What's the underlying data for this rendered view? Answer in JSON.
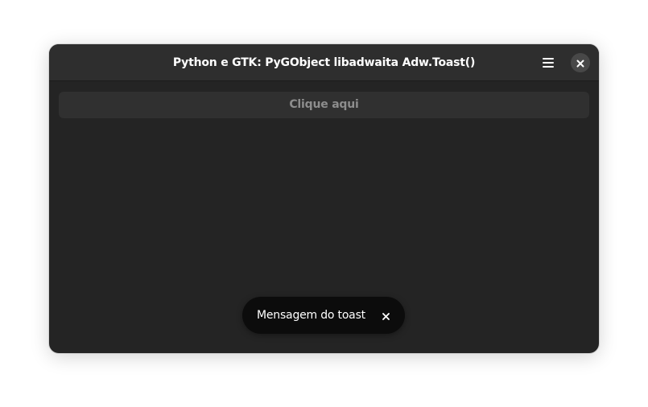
{
  "window": {
    "title": "Python e GTK: PyGObject libadwaita Adw.Toast()",
    "menu_icon": "hamburger-menu-icon",
    "close_icon": "close-icon"
  },
  "content": {
    "button_label": "Clique aqui"
  },
  "toast": {
    "message": "Mensagem do toast",
    "dismiss_icon": "close-icon"
  },
  "colors": {
    "window_bg": "#242424",
    "headerbar_bg": "#2e2e2e",
    "button_bg": "#303030",
    "toast_bg": "#0c0c0c",
    "text_primary": "#ffffff",
    "text_dim": "#8d8d8d"
  }
}
